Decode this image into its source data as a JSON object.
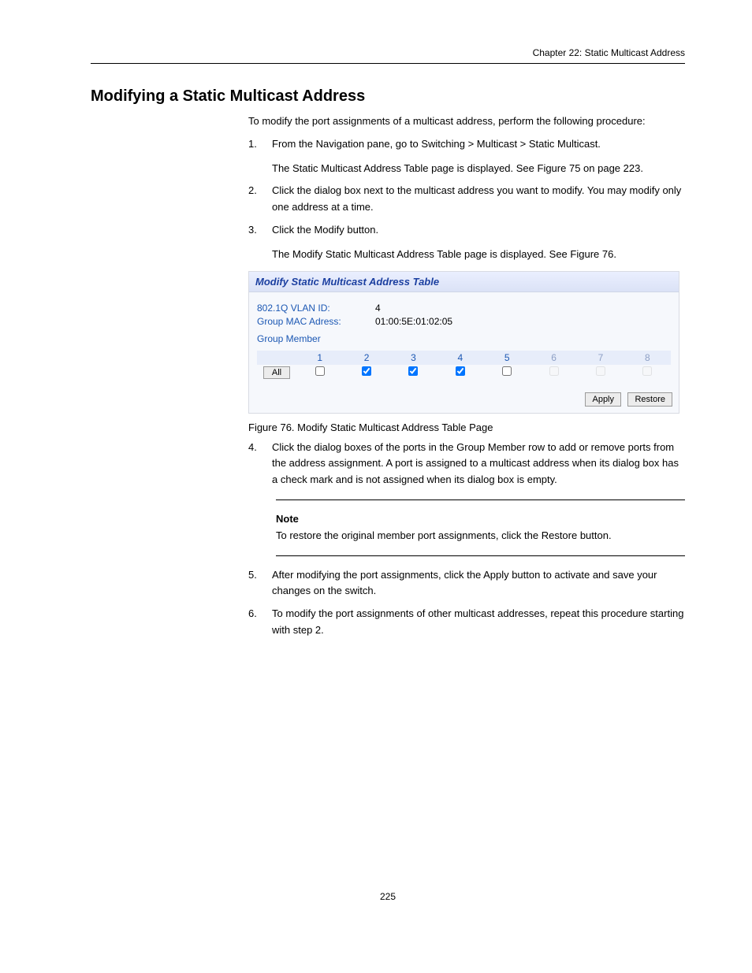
{
  "running_head": "Chapter 22: Static Multicast Address",
  "h2": "Modifying a Static Multicast Address",
  "intro": "To modify the port assignments of a multicast address, perform the following procedure:",
  "steps": {
    "s1_num": "1.",
    "s1_text_a": "From the Navigation pane, go to Switching > Multicast > Static Multicast.",
    "s1_text_b": "The Static Multicast Address Table page is displayed. See Figure 75 on page 223.",
    "s2_num": "2.",
    "s2_text_a": "Click the dialog box next to the multicast address you want to modify. You may modify only one address at a time.",
    "s3_num": "3.",
    "s3_text_a": "Click the Modify button.",
    "s3_text_b": "The Modify Static Multicast Address Table page is displayed. See Figure 76.",
    "s4_num": "4.",
    "s4_text": "Click the dialog boxes of the ports in the Group Member row to add or remove ports from the address assignment. A port is assigned to a multicast address when its dialog box has a check mark and is not assigned when its dialog box is empty.",
    "s5_num": "5.",
    "s5_text": "After modifying the port assignments, click the Apply button to activate and save your changes on the switch.",
    "s6_num": "6.",
    "s6_text": "To modify the port assignments of other multicast addresses, repeat this procedure starting with step 2."
  },
  "figure_caption": "Figure 76. Modify Static Multicast Address Table Page",
  "panel": {
    "title": "Modify Static Multicast Address Table",
    "vlan_label": "802.1Q VLAN ID:",
    "vlan_value": "4",
    "mac_label": "Group MAC Adress:",
    "mac_value": "01:00:5E:01:02:05",
    "member_label": "Group Member",
    "all_button": "All",
    "ports": [
      "1",
      "2",
      "3",
      "4",
      "5",
      "6",
      "7",
      "8"
    ],
    "checked": [
      false,
      true,
      true,
      true,
      false,
      false,
      false,
      false
    ],
    "disabled": [
      false,
      false,
      false,
      false,
      false,
      true,
      true,
      true
    ],
    "apply": "Apply",
    "restore": "Restore"
  },
  "note_label": "Note",
  "note_text": "To restore the original member port assignments, click the Restore button.",
  "footer": "225"
}
